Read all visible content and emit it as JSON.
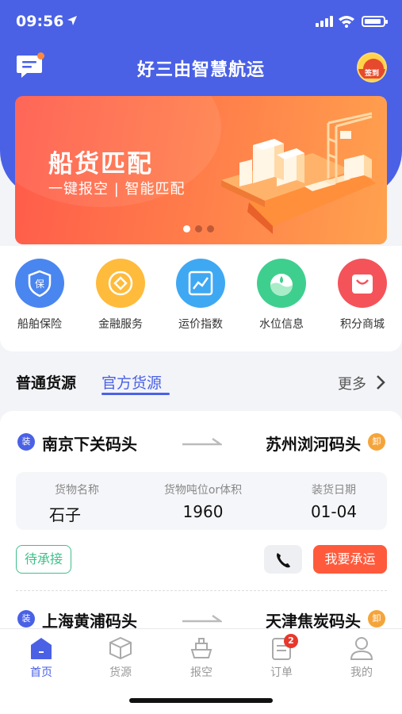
{
  "status_bar": {
    "time": "09:56"
  },
  "header": {
    "title": "好三由智慧航运",
    "checkin_label": "签到"
  },
  "banner": {
    "title": "船货匹配",
    "subtitle": "一键报空 | 智能匹配",
    "slides": 3,
    "active_slide": 1
  },
  "services": [
    {
      "label": "船舶保险",
      "icon": "shield-icon",
      "color": "#4a86f0",
      "glyph": "保"
    },
    {
      "label": "金融服务",
      "icon": "finance-icon",
      "color": "#ffbb3c"
    },
    {
      "label": "运价指数",
      "icon": "chart-icon",
      "color": "#3fa8f3"
    },
    {
      "label": "水位信息",
      "icon": "water-drop-icon",
      "color": "#3ecf8e"
    },
    {
      "label": "积分商城",
      "icon": "shopping-bag-icon",
      "color": "#f5535a"
    }
  ],
  "cargo_tabs": {
    "normal": "普通货源",
    "official": "官方货源",
    "more": "更多"
  },
  "cargo_items": [
    {
      "load_badge": "装",
      "unload_badge": "卸",
      "from": "南京下关码头",
      "to": "苏州浏河码头",
      "fields": [
        {
          "key": "货物名称",
          "value": "石子"
        },
        {
          "key": "货物吨位or体积",
          "value": "1960"
        },
        {
          "key": "装货日期",
          "value": "01-04"
        }
      ],
      "status": "待承接",
      "action": "我要承运"
    },
    {
      "load_badge": "装",
      "unload_badge": "卸",
      "from": "上海黄浦码头",
      "to": "天津焦炭码头"
    }
  ],
  "tabbar": [
    {
      "label": "首页",
      "icon": "home-icon",
      "active": true
    },
    {
      "label": "货源",
      "icon": "cargo-box-icon"
    },
    {
      "label": "报空",
      "icon": "ship-icon"
    },
    {
      "label": "订单",
      "icon": "order-icon",
      "badge": "2"
    },
    {
      "label": "我的",
      "icon": "user-icon"
    }
  ]
}
